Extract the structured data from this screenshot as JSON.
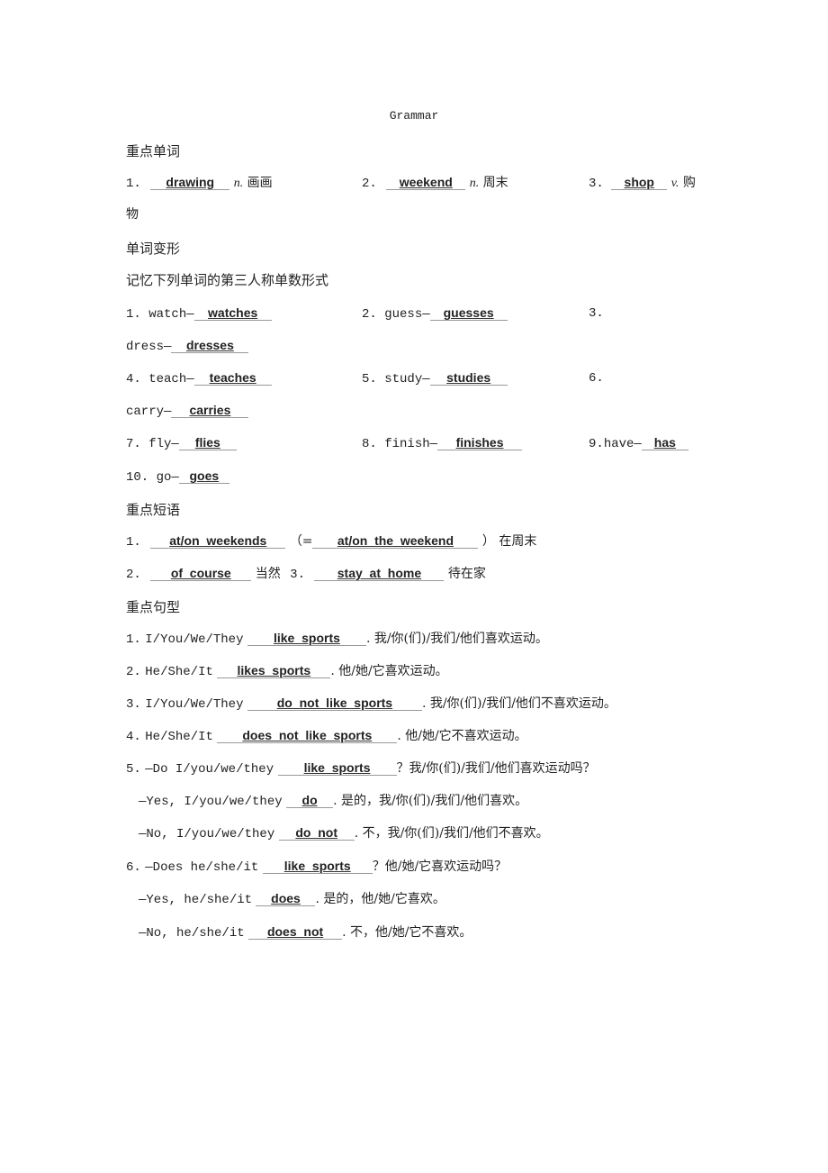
{
  "title": "Grammar",
  "sections": {
    "key_words": {
      "heading": "重点单词",
      "items": [
        {
          "num": "1.",
          "answer": "drawing",
          "pos": "n.",
          "meaning": "画画"
        },
        {
          "num": "2.",
          "answer": "weekend",
          "pos": "n.",
          "meaning": "周末"
        },
        {
          "num": "3.",
          "answer": "shop",
          "pos": "v.",
          "meaning": "购",
          "meaning_cont": "物"
        }
      ]
    },
    "word_forms": {
      "heading": "单词变形",
      "instruction": "记忆下列单词的第三人称单数形式",
      "items": [
        {
          "num": "1.",
          "word": "watch—",
          "answer": "watches"
        },
        {
          "num": "2.",
          "word": "guess—",
          "answer": "guesses"
        },
        {
          "num": "3.",
          "word": "dress—",
          "answer": "dresses"
        },
        {
          "num": "4.",
          "word": "teach—",
          "answer": "teaches"
        },
        {
          "num": "5.",
          "word": "study—",
          "answer": "studies"
        },
        {
          "num": "6.",
          "word": "carry—",
          "answer": "carries"
        },
        {
          "num": "7.",
          "word": "fly—",
          "answer": "flies"
        },
        {
          "num": "8.",
          "word": "finish—",
          "answer": "finishes"
        },
        {
          "num": "9.",
          "word": "have—",
          "answer": "has"
        },
        {
          "num": "10.",
          "word": "go—",
          "answer": "goes"
        }
      ]
    },
    "key_phrases": {
      "heading": "重点短语",
      "items": [
        {
          "num": "1.",
          "answer": "at/on  weekends",
          "eq_open": "（=",
          "eq_answer": "at/on  the  weekend",
          "eq_close": "）",
          "meaning": "在周末"
        },
        {
          "num": "2.",
          "answer": "of  course",
          "meaning": "当然"
        },
        {
          "num": "3.",
          "answer": "stay  at  home",
          "meaning": "待在家"
        }
      ]
    },
    "key_sentences": {
      "heading": "重点句型",
      "items": [
        {
          "num": "1.",
          "prefix": "I/You/We/They",
          "answer": "like  sports",
          "suffix": ". 我/你(们)/我们/他们喜欢运动。"
        },
        {
          "num": "2.",
          "prefix": "He/She/It",
          "answer": "likes  sports",
          "suffix": ". 他/她/它喜欢运动。"
        },
        {
          "num": "3.",
          "prefix": "I/You/We/They",
          "answer": "do  not  like  sports",
          "suffix": ". 我/你(们)/我们/他们不喜欢运动。"
        },
        {
          "num": "4.",
          "prefix": "He/She/It",
          "answer": "does  not  like  sports",
          "suffix": ". 他/她/它不喜欢运动。"
        },
        {
          "num": "5.",
          "prefix": "—Do I/you/we/they",
          "answer": "like  sports",
          "suffix": "？我/你(们)/我们/他们喜欢运动吗？"
        },
        {
          "num": "",
          "prefix": "—Yes, I/you/we/they",
          "answer": "do",
          "suffix": ". 是的，我/你(们)/我们/他们喜欢。"
        },
        {
          "num": "",
          "prefix": "—No, I/you/we/they",
          "answer": "do  not",
          "suffix": ". 不，我/你(们)/我们/他们不喜欢。"
        },
        {
          "num": "6.",
          "prefix": "—Does he/she/it",
          "answer": "like  sports",
          "suffix": "？他/她/它喜欢运动吗？"
        },
        {
          "num": "",
          "prefix": "—Yes, he/she/it",
          "answer": "does",
          "suffix": ". 是的，他/她/它喜欢。"
        },
        {
          "num": "",
          "prefix": "—No, he/she/it",
          "answer": "does  not",
          "suffix": ". 不，他/她/它不喜欢。"
        }
      ]
    }
  }
}
